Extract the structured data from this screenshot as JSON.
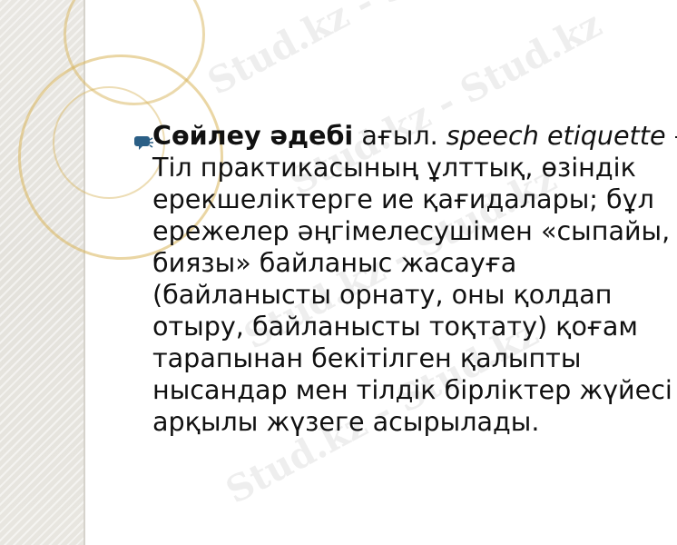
{
  "slide": {
    "term": "Сөйлеу әдебі",
    "lang_abbr": " ағыл. ",
    "english_term": "speech etiquette",
    "definition": " – Тіл практикасының ұлттық, өзіндік ерекшеліктерге ие қағидалары; бұл ережелер әңгімелесушімен «сыпайы, биязы» байланыс жасауға (байланысты орнату, оны қолдап отыру, байланысты тоқтату) қоғам тарапынан бекітілген қалыпты нысандар мен тілдік бірліктер жүйесі арқылы жүзеге асырылады."
  },
  "watermark": {
    "text": "Stud.kz - Stud.kz"
  },
  "colors": {
    "bullet": "#2b5f86",
    "ring_gold": "#d8b45a",
    "strip": "#e6e4de",
    "text": "#111111"
  }
}
